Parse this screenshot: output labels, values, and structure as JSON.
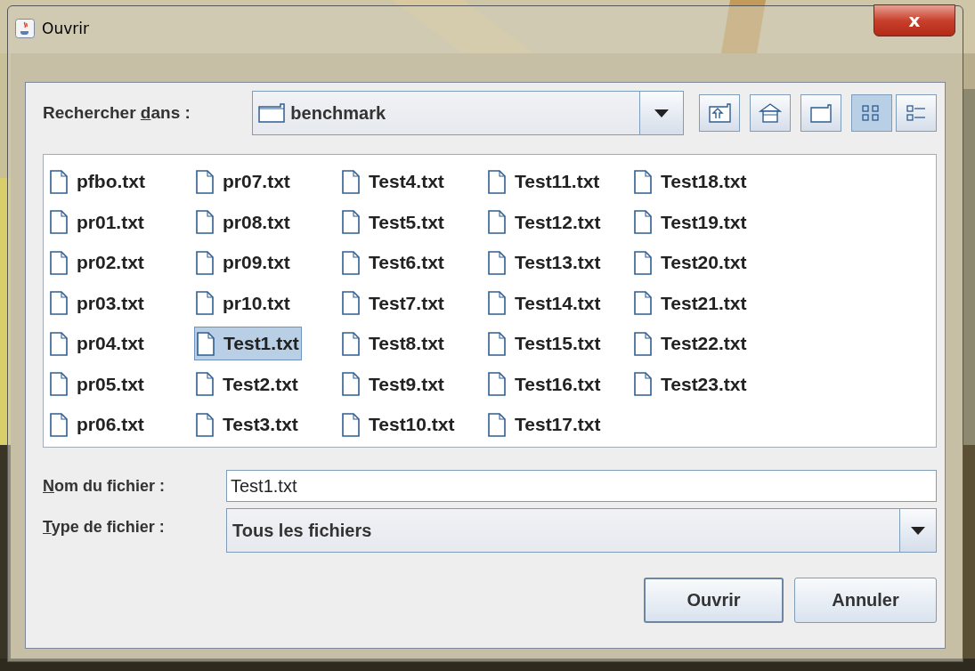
{
  "window": {
    "title": "Ouvrir",
    "close": "x"
  },
  "look_in": {
    "label": {
      "pre": "Rechercher ",
      "key": "d",
      "post": "ans :"
    },
    "value": "benchmark"
  },
  "toolbar": [
    {
      "kind": "up"
    },
    {
      "kind": "home"
    },
    {
      "kind": "new-folder"
    },
    {
      "kind": "list",
      "selected": true
    },
    {
      "kind": "details",
      "selected": false
    }
  ],
  "files": [
    {
      "name": "pfbo.txt",
      "selected": false
    },
    {
      "name": "pr01.txt",
      "selected": false
    },
    {
      "name": "pr02.txt",
      "selected": false
    },
    {
      "name": "pr03.txt",
      "selected": false
    },
    {
      "name": "pr04.txt",
      "selected": false
    },
    {
      "name": "pr05.txt",
      "selected": false
    },
    {
      "name": "pr06.txt",
      "selected": false
    },
    {
      "name": "pr07.txt",
      "selected": false
    },
    {
      "name": "pr08.txt",
      "selected": false
    },
    {
      "name": "pr09.txt",
      "selected": false
    },
    {
      "name": "pr10.txt",
      "selected": false
    },
    {
      "name": "Test1.txt",
      "selected": true
    },
    {
      "name": "Test2.txt",
      "selected": false
    },
    {
      "name": "Test3.txt",
      "selected": false
    },
    {
      "name": "Test4.txt",
      "selected": false
    },
    {
      "name": "Test5.txt",
      "selected": false
    },
    {
      "name": "Test6.txt",
      "selected": false
    },
    {
      "name": "Test7.txt",
      "selected": false
    },
    {
      "name": "Test8.txt",
      "selected": false
    },
    {
      "name": "Test9.txt",
      "selected": false
    },
    {
      "name": "Test10.txt",
      "selected": false
    },
    {
      "name": "Test11.txt",
      "selected": false
    },
    {
      "name": "Test12.txt",
      "selected": false
    },
    {
      "name": "Test13.txt",
      "selected": false
    },
    {
      "name": "Test14.txt",
      "selected": false
    },
    {
      "name": "Test15.txt",
      "selected": false
    },
    {
      "name": "Test16.txt",
      "selected": false
    },
    {
      "name": "Test17.txt",
      "selected": false
    },
    {
      "name": "Test18.txt",
      "selected": false
    },
    {
      "name": "Test19.txt",
      "selected": false
    },
    {
      "name": "Test20.txt",
      "selected": false
    },
    {
      "name": "Test21.txt",
      "selected": false
    },
    {
      "name": "Test22.txt",
      "selected": false
    },
    {
      "name": "Test23.txt",
      "selected": false
    }
  ],
  "file_name": {
    "label": {
      "key": "N",
      "post": "om du fichier :"
    },
    "value": "Test1.txt"
  },
  "file_type": {
    "label": {
      "key": "T",
      "post": "ype de fichier :"
    },
    "value": "Tous les fichiers"
  },
  "buttons": [
    {
      "label": "Ouvrir",
      "default": true
    },
    {
      "label": "Annuler",
      "default": false
    }
  ]
}
